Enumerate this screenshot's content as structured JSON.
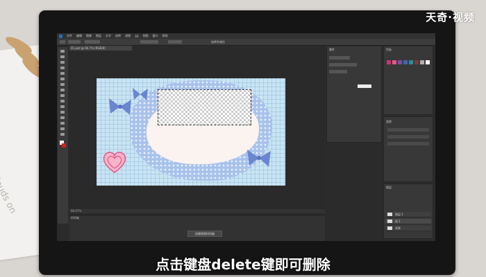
{
  "watermark": "天奇·视频",
  "subtitle": "点击键盘delete键即可删除",
  "photoshop": {
    "menu_items": [
      "文件",
      "编辑",
      "图像",
      "图层",
      "文字",
      "选择",
      "滤镜",
      "3D",
      "视图",
      "窗口",
      "帮助"
    ],
    "options_bar_button": "选择并遮住",
    "document_tab": "01.psd @ 66.7% (RGB/8)",
    "status_text": "66.67%",
    "timeline_label": "时间轴",
    "timeline_button": "创建视频时间轴",
    "panels": {
      "mid_panel_header": "属性",
      "right_panel_header": "色板",
      "layers_tab": "图层",
      "properties_section": "变换"
    },
    "swatch_colors": [
      "#c8386c",
      "#e3558a",
      "#7a4fa3",
      "#3d67b5",
      "#2a8f9c",
      "#7b3c3c",
      "#b0b0b0",
      "#ffffff"
    ],
    "layer_rows": [
      "图层 1",
      "组 1",
      "背景"
    ]
  },
  "colors": {
    "accent_blue": "#1b6fc6",
    "bow_blue": "#6a86cf",
    "heart_pink": "#f08eaa",
    "cloud_blue": "#a8c2ec"
  }
}
